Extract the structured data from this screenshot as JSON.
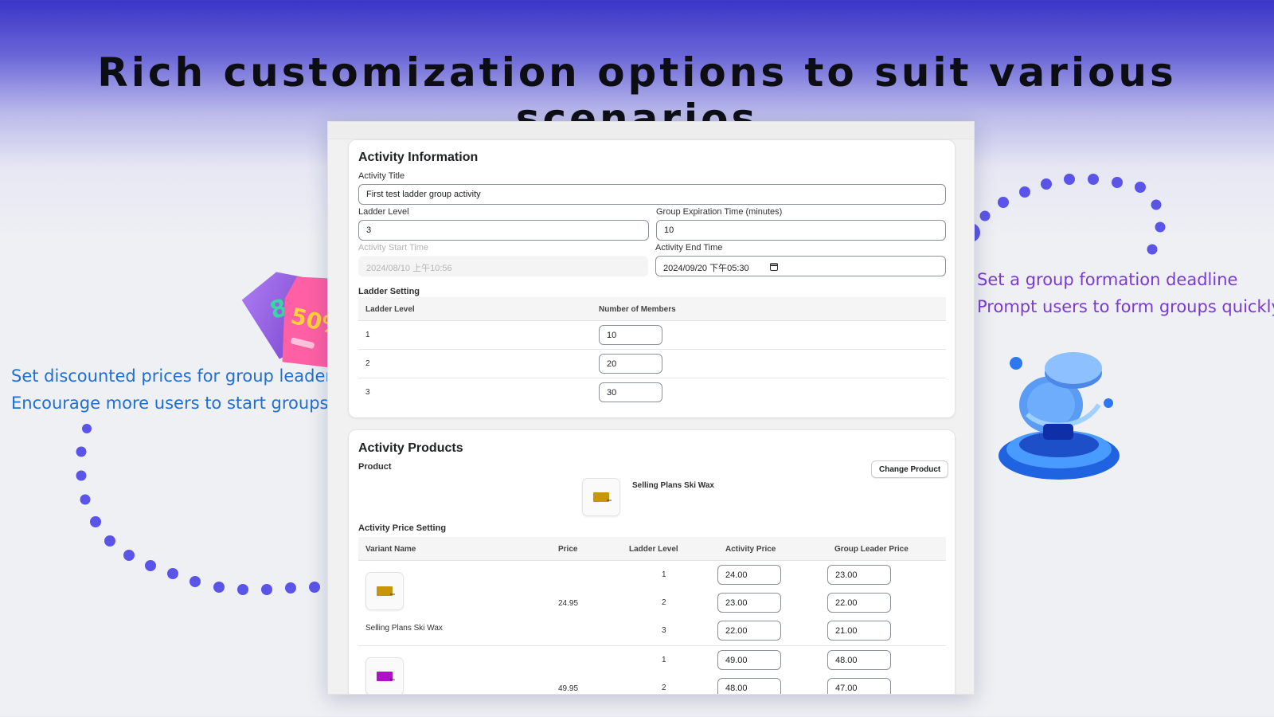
{
  "headline": "Rich customization options to suit various scenarios",
  "left_callout": {
    "line1": "Set discounted prices for group leaders",
    "line2": "Encourage more users to start groups"
  },
  "right_callout": {
    "line1": "Set a group formation deadline",
    "line2": "Prompt users to form groups quickly"
  },
  "activity_info": {
    "title": "Activity Information",
    "activity_title_label": "Activity Title",
    "activity_title_value": "First test ladder group activity",
    "ladder_level_label": "Ladder Level",
    "ladder_level_value": "3",
    "expiration_label": "Group Expiration Time (minutes)",
    "expiration_value": "10",
    "start_time_label": "Activity Start Time",
    "start_time_value": "2024/08/10 上午10:56",
    "end_time_label": "Activity End Time",
    "end_time_value": "2024/09/20 下午05:30",
    "ladder_setting_label": "Ladder Setting",
    "ladder_columns": [
      "Ladder Level",
      "Number of Members"
    ],
    "ladder_rows": [
      {
        "level": "1",
        "members": "10"
      },
      {
        "level": "2",
        "members": "20"
      },
      {
        "level": "3",
        "members": "30"
      }
    ]
  },
  "activity_products": {
    "title": "Activity Products",
    "product_label": "Product",
    "change_product_button": "Change Product",
    "product_name": "Selling Plans Ski Wax",
    "price_setting_label": "Activity Price Setting",
    "price_columns": [
      "Variant Name",
      "Price",
      "Ladder Level",
      "Activity Price",
      "Group Leader Price"
    ],
    "variants": [
      {
        "name": "Selling Plans Ski Wax",
        "price": "24.95",
        "color": "#c8960a",
        "tiers": [
          {
            "level": "1",
            "activity_price": "24.00",
            "leader_price": "23.00"
          },
          {
            "level": "2",
            "activity_price": "23.00",
            "leader_price": "22.00"
          },
          {
            "level": "3",
            "activity_price": "22.00",
            "leader_price": "21.00"
          }
        ]
      },
      {
        "name": "",
        "price": "49.95",
        "color": "#b10fc9",
        "tiers": [
          {
            "level": "1",
            "activity_price": "49.00",
            "leader_price": "48.00"
          },
          {
            "level": "2",
            "activity_price": "48.00",
            "leader_price": "47.00"
          }
        ]
      }
    ]
  },
  "icons": {
    "price_tags": "discount-tags-icon",
    "coin_stack": "coin-stack-icon",
    "calendar": "calendar-icon"
  },
  "colors": {
    "accent_dots": "#5a55e8",
    "left_text": "#1f6fd1",
    "right_text": "#7a3ad6",
    "wax_gold": "#c8960a",
    "wax_purple": "#b10fc9"
  }
}
